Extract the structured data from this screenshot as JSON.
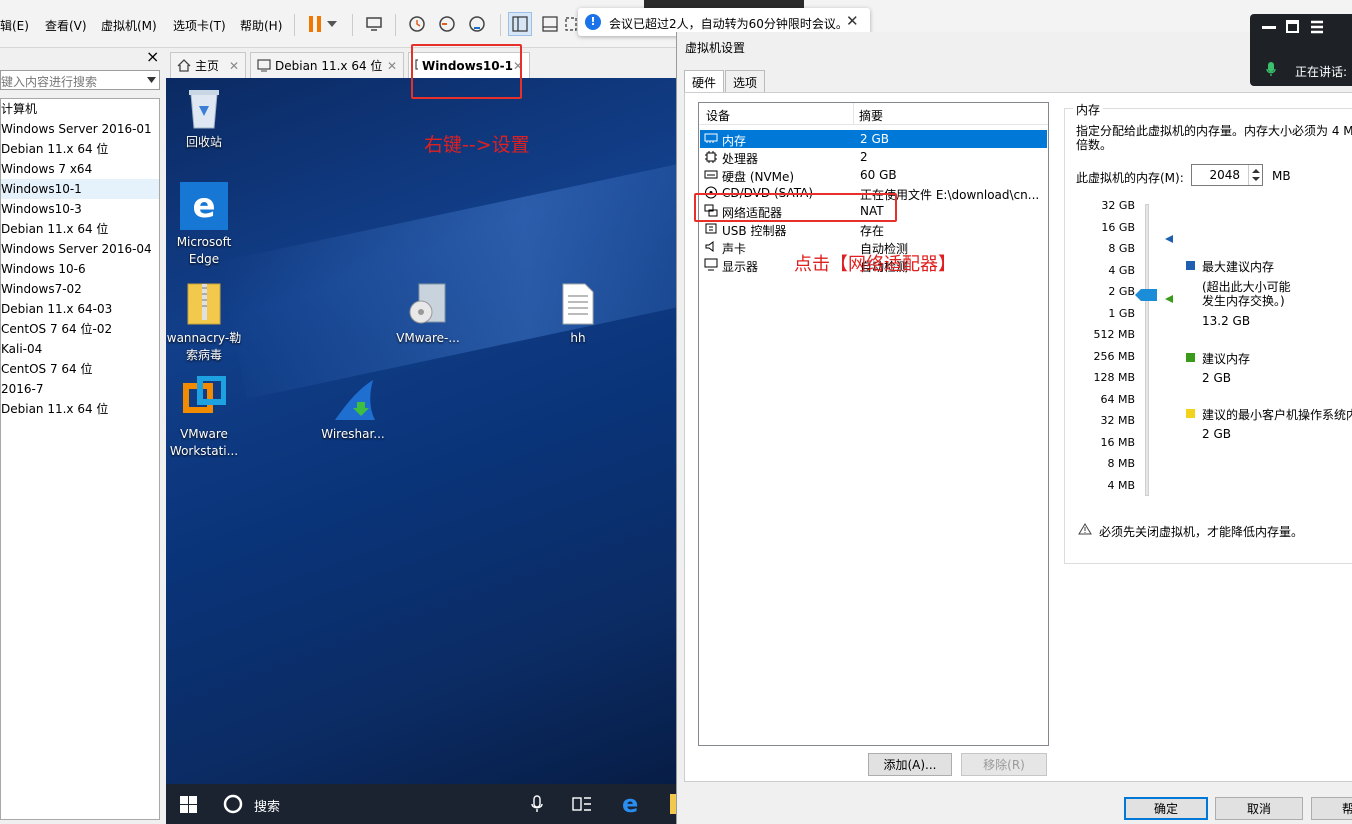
{
  "menubar": {
    "items": [
      "辑(E)",
      "查看(V)",
      "虚拟机(M)",
      "选项卡(T)",
      "帮助(H)"
    ]
  },
  "library": {
    "close": "×",
    "search_placeholder": "键入内容进行搜索",
    "items": [
      "计算机",
      "Windows Server 2016-01",
      "Debian 11.x 64 位",
      "Windows 7 x64",
      "Windows10-1",
      "Windows10-3",
      "Debian 11.x 64 位",
      "Windows Server 2016-04",
      "Windows 10-6",
      "Windows7-02",
      "Debian 11.x 64-03",
      "CentOS 7 64 位-02",
      "Kali-04",
      "CentOS 7 64 位",
      "2016-7",
      "Debian 11.x 64 位"
    ],
    "selected_index": 4
  },
  "tabs": [
    {
      "label": "主页",
      "icon": "home-icon"
    },
    {
      "label": "Debian 11.x 64 位",
      "icon": "vm-icon"
    },
    {
      "label": "Windows10-1",
      "icon": "vm-running-icon"
    }
  ],
  "desktop": {
    "icons": [
      {
        "label": "回收站",
        "icon": "recycle-bin-icon"
      },
      {
        "label": "Microsoft Edge",
        "icon": "edge-icon"
      },
      {
        "label": "wannacry-勒索病毒",
        "icon": "zip-folder-icon"
      },
      {
        "label": "VMware Workstati...",
        "icon": "vmware-icon"
      },
      {
        "label": "VMware-...",
        "icon": "installer-icon"
      },
      {
        "label": "Wireshar...",
        "icon": "wireshark-icon"
      },
      {
        "label": "hh",
        "icon": "text-file-icon"
      }
    ],
    "annotation_right_click": "右键-->设置",
    "annotation_click_network": "点击【网络适配器】"
  },
  "taskbar": {
    "search_label": "搜索"
  },
  "notification": {
    "text": "会议已超过2人，自动转为60分钟限时会议。",
    "close": "✕"
  },
  "meeting": {
    "speaking_label": "正在讲话:"
  },
  "dialog": {
    "title": "虚拟机设置",
    "tabs": [
      "硬件",
      "选项"
    ],
    "columns": {
      "device": "设备",
      "summary": "摘要"
    },
    "devices": [
      {
        "name": "内存",
        "summary": "2 GB",
        "icon": "memory-icon"
      },
      {
        "name": "处理器",
        "summary": "2",
        "icon": "cpu-icon"
      },
      {
        "name": "硬盘 (NVMe)",
        "summary": "60 GB",
        "icon": "disk-icon"
      },
      {
        "name": "CD/DVD (SATA)",
        "summary": "正在使用文件 E:\\download\\cn...",
        "icon": "cdrom-icon"
      },
      {
        "name": "网络适配器",
        "summary": "NAT",
        "icon": "network-icon"
      },
      {
        "name": "USB 控制器",
        "summary": "存在",
        "icon": "usb-icon"
      },
      {
        "name": "声卡",
        "summary": "自动检测",
        "icon": "speaker-icon"
      },
      {
        "name": "显示器",
        "summary": "自动检测",
        "icon": "monitor-icon"
      }
    ],
    "selected_device": 0,
    "add_button": "添加(A)...",
    "remove_button": "移除(R)",
    "ok_button": "确定",
    "cancel_button": "取消",
    "help_button": "帮",
    "memory": {
      "group_title": "内存",
      "description": "指定分配给此虚拟机的内存量。内存大小必须为 4 M的倍数。",
      "field_label": "此虚拟机的内存(M):",
      "value": "2048",
      "unit": "MB",
      "scale": [
        "32 GB",
        "16 GB",
        "8 GB",
        "4 GB",
        "2 GB",
        "1 GB",
        "512 MB",
        "256 MB",
        "128 MB",
        "64 MB",
        "32 MB",
        "16 MB",
        "8 MB",
        "4 MB"
      ],
      "max_recommended_label": "最大建议内存",
      "max_recommended_note": "(超出此大小可能发生内存交换。)",
      "max_recommended_value": "13.2 GB",
      "recommended_label": "建议内存",
      "recommended_value": "2 GB",
      "min_guest_label": "建议的最小客户机操作系统内",
      "min_guest_value": "2 GB",
      "warning": "必须先关闭虚拟机，才能降低内存量。",
      "colors": {
        "max": "#1f5fb2",
        "recommended": "#3a9a1a",
        "min": "#f2d21b"
      }
    }
  }
}
